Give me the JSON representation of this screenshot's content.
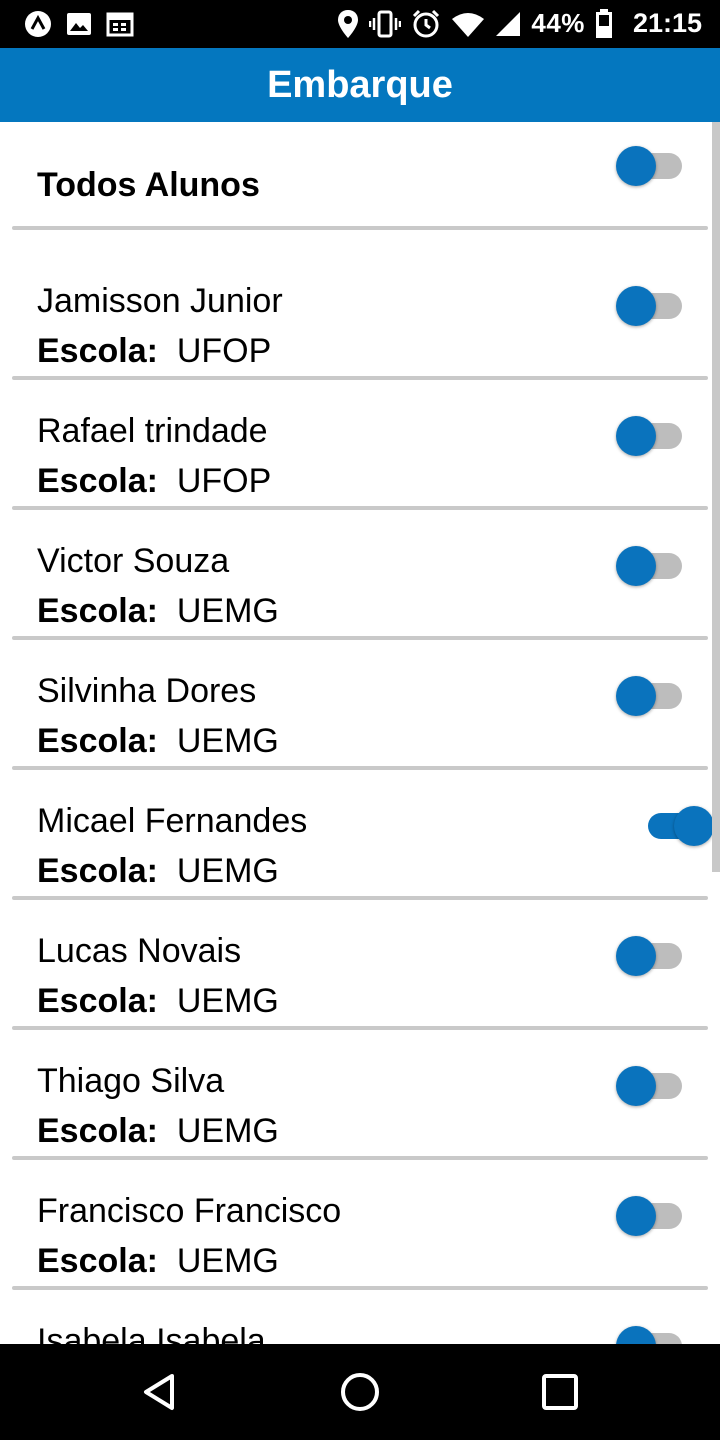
{
  "status_bar": {
    "battery_text": "44%",
    "time": "21:15",
    "icons": [
      "app-logo-icon",
      "image-icon",
      "calendar-icon",
      "location-icon",
      "vibrate-icon",
      "alarm-icon",
      "wifi-icon",
      "signal-icon",
      "battery-icon"
    ]
  },
  "app_bar": {
    "title": "Embarque"
  },
  "colors": {
    "accent": "#0477bf",
    "toggle_track_off": "#bdbdbd"
  },
  "all_students": {
    "label": "Todos Alunos",
    "toggle_on": false
  },
  "school_prefix": "Escola:",
  "students": [
    {
      "name": "Jamisson Junior",
      "school": "UFOP",
      "boarded": false
    },
    {
      "name": "Rafael trindade",
      "school": "UFOP",
      "boarded": false
    },
    {
      "name": "Victor Souza",
      "school": "UEMG",
      "boarded": false
    },
    {
      "name": "Silvinha Dores",
      "school": "UEMG",
      "boarded": false
    },
    {
      "name": "Micael Fernandes",
      "school": "UEMG",
      "boarded": true
    },
    {
      "name": "Lucas Novais",
      "school": "UEMG",
      "boarded": false
    },
    {
      "name": "Thiago Silva",
      "school": "UEMG",
      "boarded": false
    },
    {
      "name": "Francisco Francisco",
      "school": "UEMG",
      "boarded": false
    },
    {
      "name": "Isabela Isabela",
      "school": "",
      "boarded": false
    }
  ],
  "nav_bar": {
    "icons": [
      "back-icon",
      "home-icon",
      "recents-icon"
    ]
  }
}
